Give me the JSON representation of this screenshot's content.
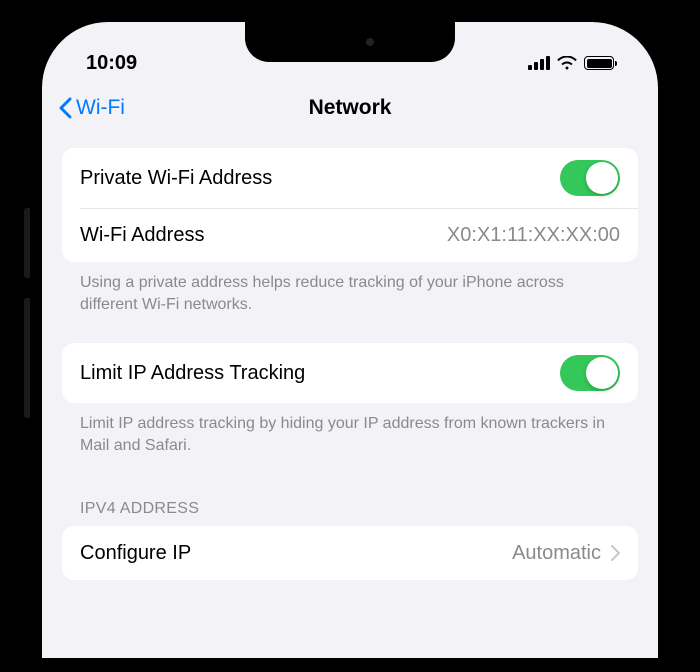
{
  "status": {
    "time": "10:09"
  },
  "nav": {
    "back_label": "Wi-Fi",
    "title": "Network"
  },
  "private_addr": {
    "toggle_label": "Private Wi-Fi Address",
    "toggle_on": true,
    "address_label": "Wi-Fi Address",
    "address_value": "X0:X1:11:XX:XX:00",
    "footer": "Using a private address helps reduce tracking of your iPhone across different Wi-Fi networks."
  },
  "limit_ip": {
    "label": "Limit IP Address Tracking",
    "toggle_on": true,
    "footer": "Limit IP address tracking by hiding your IP address from known trackers in Mail and Safari."
  },
  "ipv4": {
    "header": "IPV4 Address",
    "configure_label": "Configure IP",
    "configure_value": "Automatic"
  },
  "colors": {
    "accent": "#007aff",
    "toggle_on": "#34c759"
  }
}
